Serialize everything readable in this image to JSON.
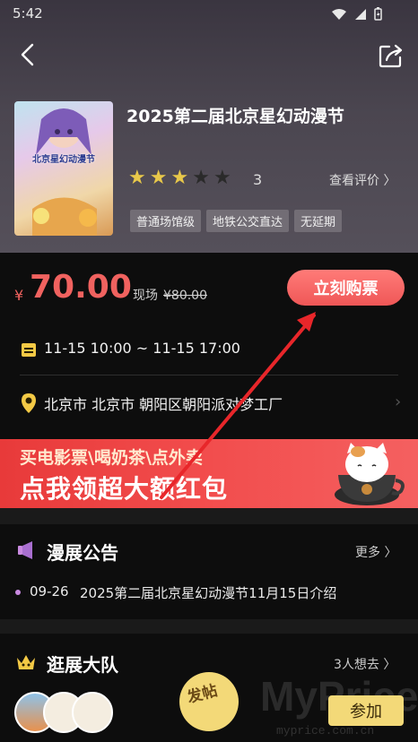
{
  "status_bar": {
    "time": "5:42"
  },
  "event": {
    "title": "2025第二届北京星幻动漫节",
    "poster_text": "北京星幻动漫节",
    "rating": 3,
    "rating_max": 5,
    "rating_count": "3",
    "review_link": "查看评价 〉",
    "tags": [
      "普通场馆级",
      "地铁公交直达",
      "无延期"
    ]
  },
  "ticket": {
    "currency": "¥",
    "price": "70.00",
    "onsite_label": "现场",
    "onsite_price": "¥80.00",
    "buy_label": "立刻购票"
  },
  "schedule": {
    "time_range": "11-15 10:00 ~ 11-15 17:00"
  },
  "location": {
    "address": "北京市 北京市 朝阳区朝阳派对梦工厂"
  },
  "banner": {
    "line1": "买电影票\\喝奶茶\\点外卖",
    "line2": "点我领超大额红包"
  },
  "notice": {
    "title": "漫展公告",
    "more_label": "更多 〉",
    "items": [
      {
        "date": "09-26",
        "text": "2025第二届北京星幻动漫节11月15日介绍"
      }
    ]
  },
  "team": {
    "title": "逛展大队",
    "count_label": "3人想去 〉",
    "post_badge": "发帖",
    "join_label": "参加"
  },
  "watermark": {
    "brand": "MyPrice",
    "url": "myprice.com.cn"
  },
  "colors": {
    "accent": "#f0625f",
    "star": "#e8c84a",
    "badge": "#f3d978"
  }
}
